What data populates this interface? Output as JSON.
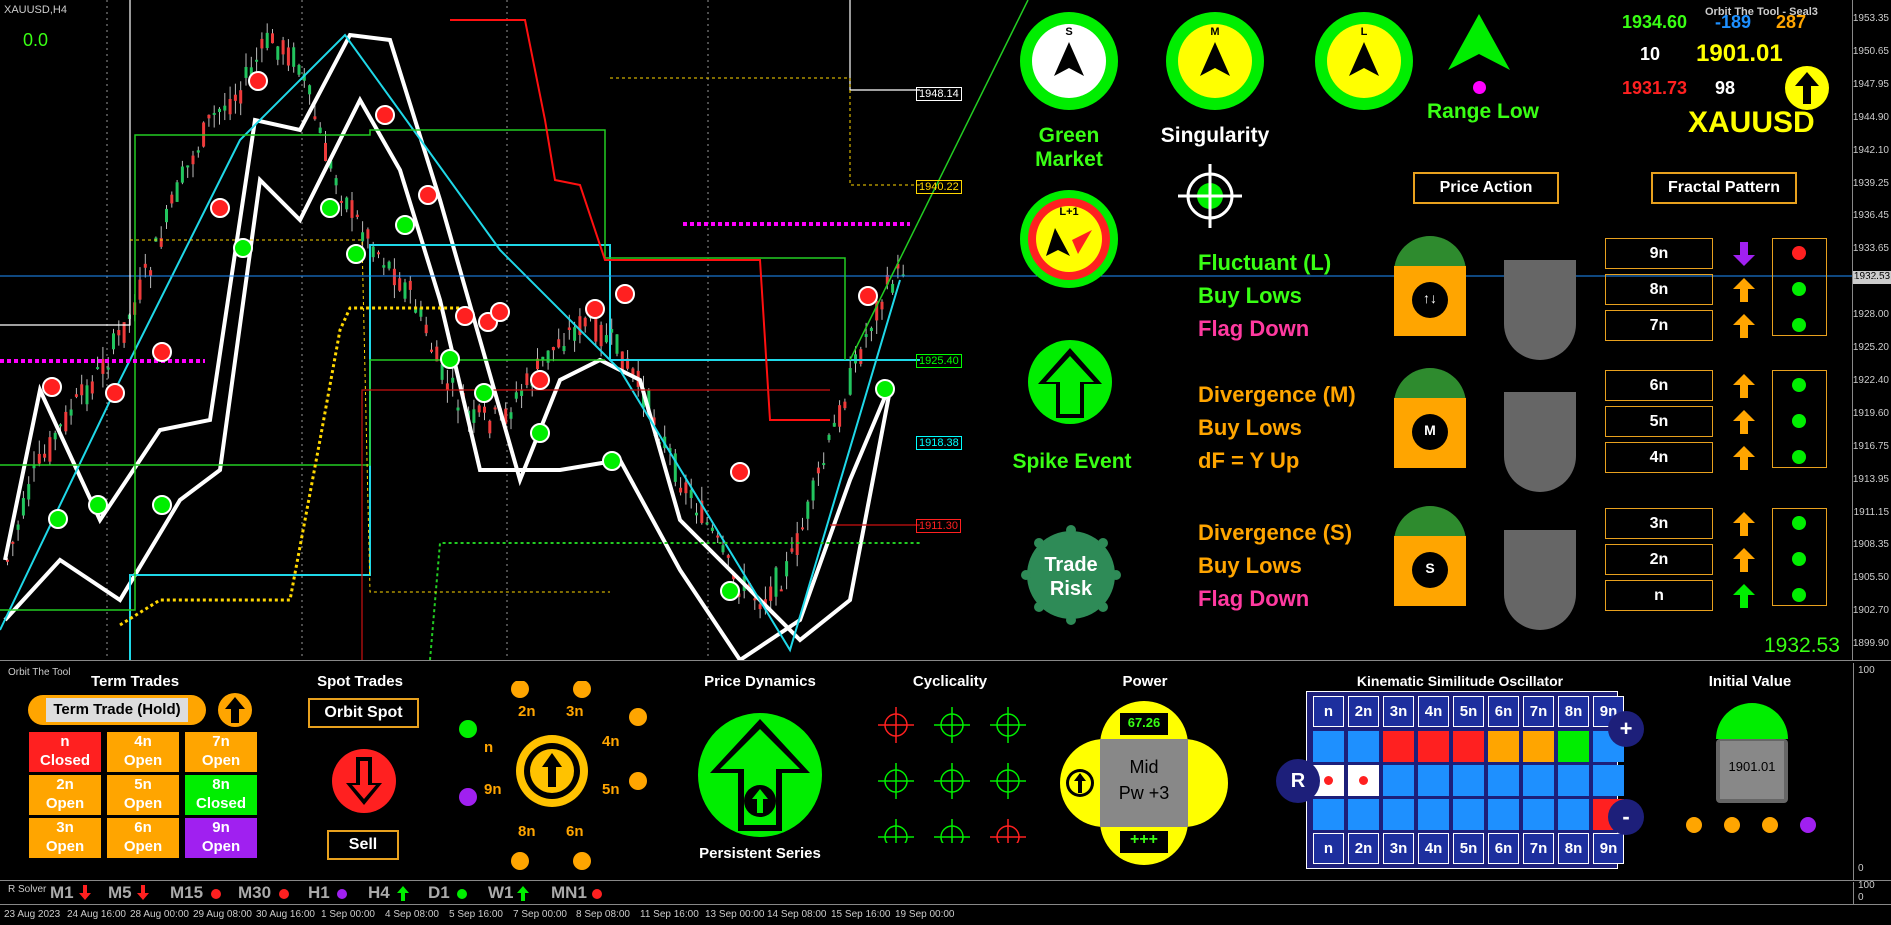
{
  "chart": {
    "symbol": "XAUUSD,H4",
    "top_left_value": "0.0",
    "price_ticks": [
      "1953.35",
      "1950.65",
      "1947.95",
      "1944.90",
      "1942.10",
      "1939.25",
      "1936.45",
      "1933.65",
      "1930.85",
      "1928.00",
      "1925.20",
      "1922.40",
      "1919.60",
      "1916.75",
      "1913.95",
      "1911.15",
      "1908.35",
      "1905.50",
      "1902.70",
      "1899.90"
    ],
    "current_price_tag": "1932.53",
    "level_labels": [
      {
        "text": "1948.14",
        "color": "#ffffff"
      },
      {
        "text": "1940.22",
        "color": "#ffd700"
      },
      {
        "text": "1925.40",
        "color": "#00ff00"
      },
      {
        "text": "1918.38",
        "color": "#00ffff"
      },
      {
        "text": "1911.30",
        "color": "#ff2020"
      }
    ],
    "price_display": {
      "value": "1932.53",
      "color": "#00ff00"
    }
  },
  "header": {
    "tool_title": "Orbit The Tool - Seal3",
    "stats": {
      "high": "1934.60",
      "diff": "-189",
      "count": "287",
      "ten": "10",
      "price": "1901.01",
      "low": "1931.73",
      "n98": "98"
    },
    "symbol_large": "XAUUSD"
  },
  "indicators": {
    "market": {
      "letter": "S",
      "label": "Green Market"
    },
    "singularity": {
      "letter": "M",
      "label": "Singularity"
    },
    "range": {
      "letter": "L",
      "label": "Range Low"
    },
    "lplus": {
      "letter": "L+1"
    },
    "spike": {
      "label": "Spike Event"
    },
    "trade_risk": {
      "line1": "Trade",
      "line2": "Risk"
    }
  },
  "buttons": {
    "price_action": "Price Action",
    "fractal_pattern": "Fractal Pattern"
  },
  "sections": [
    {
      "lines": [
        {
          "text": "Fluctuant (L)",
          "color": "#39ff14"
        },
        {
          "text": "Buy Lows",
          "color": "#39ff14"
        },
        {
          "text": "Flag Down",
          "color": "#ff3aa0"
        }
      ],
      "badge": "↑↓",
      "boxes": [
        "9n",
        "8n",
        "7n"
      ],
      "arrows": [
        {
          "c": "#a020f0",
          "dir": "down"
        },
        {
          "c": "#ffa500",
          "dir": "up"
        },
        {
          "c": "#ffa500",
          "dir": "up"
        }
      ],
      "lights": [
        "#ff2020",
        "#00ee00",
        "#00ee00"
      ]
    },
    {
      "lines": [
        {
          "text": "Divergence (M)",
          "color": "#ffa500"
        },
        {
          "text": "Buy Lows",
          "color": "#ffa500"
        },
        {
          "text": "dF = Y Up",
          "color": "#ffa500"
        }
      ],
      "badge": "M",
      "boxes": [
        "6n",
        "5n",
        "4n"
      ],
      "arrows": [
        {
          "c": "#ffa500",
          "dir": "up"
        },
        {
          "c": "#ffa500",
          "dir": "up"
        },
        {
          "c": "#ffa500",
          "dir": "up"
        }
      ],
      "lights": [
        "#00ee00",
        "#00ee00",
        "#00ee00"
      ]
    },
    {
      "lines": [
        {
          "text": "Divergence (S)",
          "color": "#ffa500"
        },
        {
          "text": "Buy Lows",
          "color": "#ffa500"
        },
        {
          "text": "Flag Down",
          "color": "#ff3aa0"
        }
      ],
      "badge": "S",
      "boxes": [
        "3n",
        "2n",
        "n"
      ],
      "arrows": [
        {
          "c": "#ffa500",
          "dir": "up"
        },
        {
          "c": "#ffa500",
          "dir": "up"
        },
        {
          "c": "#00ee00",
          "dir": "up"
        }
      ],
      "lights": [
        "#00ee00",
        "#00ee00",
        "#00ee00"
      ]
    }
  ],
  "panel": {
    "subwindow_title": "Orbit The Tool",
    "term_trades": {
      "title": "Term Trades",
      "hold_label": "Term Trade (Hold)",
      "cells": [
        {
          "l1": "n",
          "l2": "Closed",
          "bg": "#ff2020"
        },
        {
          "l1": "4n",
          "l2": "Open",
          "bg": "#ffa500"
        },
        {
          "l1": "7n",
          "l2": "Open",
          "bg": "#ffa500"
        },
        {
          "l1": "2n",
          "l2": "Open",
          "bg": "#ffa500"
        },
        {
          "l1": "5n",
          "l2": "Open",
          "bg": "#ffa500"
        },
        {
          "l1": "8n",
          "l2": "Closed",
          "bg": "#00ee00"
        },
        {
          "l1": "3n",
          "l2": "Open",
          "bg": "#ffa500"
        },
        {
          "l1": "6n",
          "l2": "Open",
          "bg": "#ffa500"
        },
        {
          "l1": "9n",
          "l2": "Open",
          "bg": "#a020f0"
        }
      ]
    },
    "spot_trades": {
      "title": "Spot Trades",
      "orbit_spot": "Orbit Spot",
      "sell": "Sell"
    },
    "orbit_labels": [
      "2n",
      "3n",
      "4n",
      "5n",
      "6n",
      "8n",
      "9n",
      "n"
    ],
    "price_dynamics": {
      "title": "Price Dynamics",
      "label": "Persistent Series"
    },
    "cyclicality": {
      "title": "Cyclicality"
    },
    "power": {
      "title": "Power",
      "value": "67.26",
      "mid1": "Mid",
      "mid2": "Pw +3",
      "plus": "+++"
    },
    "kso": {
      "title": "Kinematic Similitude Oscillator",
      "headers": [
        "n",
        "2n",
        "3n",
        "4n",
        "5n",
        "6n",
        "7n",
        "8n",
        "9n"
      ],
      "plus": "+",
      "minus": "-",
      "r": "R",
      "row1": [
        "#1e90ff",
        "#1e90ff",
        "#ff2020",
        "#ff2020",
        "#ff2020",
        "#ffa500",
        "#ffa500",
        "#00ee00",
        "#1e90ff"
      ],
      "row2": [
        "#ffffff",
        "#ffffff",
        "#1e90ff",
        "#1e90ff",
        "#1e90ff",
        "#1e90ff",
        "#1e90ff",
        "#1e90ff",
        "#1e90ff"
      ],
      "row3": [
        "#1e90ff",
        "#1e90ff",
        "#1e90ff",
        "#1e90ff",
        "#1e90ff",
        "#1e90ff",
        "#1e90ff",
        "#1e90ff",
        "#ff2020"
      ]
    },
    "initial_value": {
      "title": "Initial Value",
      "value": "1901.01"
    },
    "scale": {
      "top": "100",
      "bottom": "0"
    }
  },
  "timeframes": {
    "solver": "R Solver",
    "items": [
      {
        "label": "M1",
        "mark": "down",
        "color": "#ff2020"
      },
      {
        "label": "M5",
        "mark": "down",
        "color": "#ff2020"
      },
      {
        "label": "M15",
        "mark": "dot",
        "color": "#ff2020"
      },
      {
        "label": "M30",
        "mark": "dot",
        "color": "#ff2020"
      },
      {
        "label": "H1",
        "mark": "dot",
        "color": "#a020f0"
      },
      {
        "label": "H4",
        "mark": "up",
        "color": "#00ee00"
      },
      {
        "label": "D1",
        "mark": "dot",
        "color": "#00ee00"
      },
      {
        "label": "W1",
        "mark": "up",
        "color": "#00ee00"
      },
      {
        "label": "MN1",
        "mark": "dot",
        "color": "#ff2020"
      }
    ],
    "scale": {
      "top": "100",
      "bottom": "0"
    }
  },
  "dates": [
    "23 Aug 2023",
    "24 Aug 16:00",
    "28 Aug 00:00",
    "29 Aug 08:00",
    "30 Aug 16:00",
    "1 Sep 00:00",
    "4 Sep 08:00",
    "5 Sep 16:00",
    "7 Sep 00:00",
    "8 Sep 08:00",
    "11 Sep 16:00",
    "13 Sep 00:00",
    "14 Sep 08:00",
    "15 Sep 16:00",
    "19 Sep 00:00"
  ]
}
